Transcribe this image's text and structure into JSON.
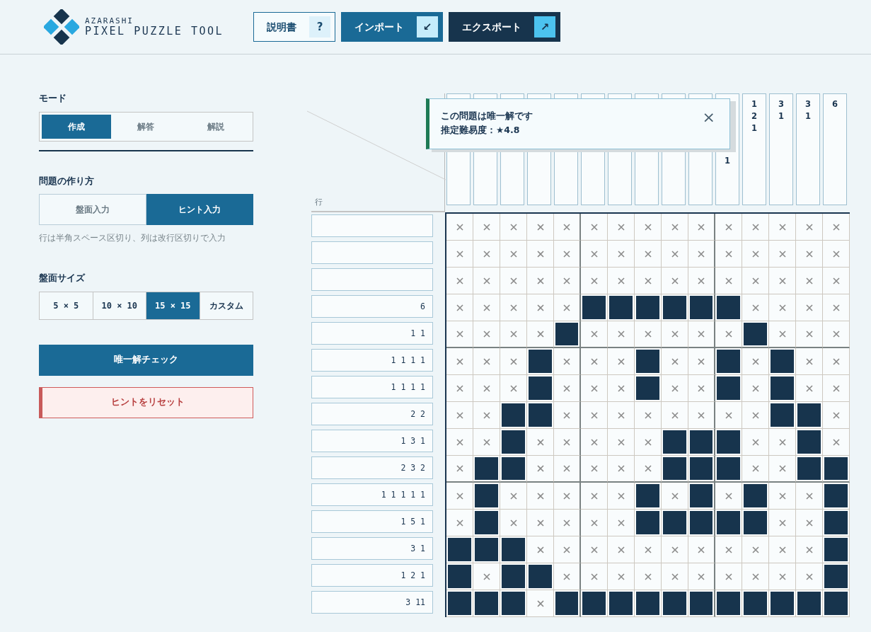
{
  "header": {
    "logo_top": "AZARASHI",
    "logo_title": "PIXEL PUZZLE TOOL",
    "buttons": [
      {
        "label": "説明書",
        "icon": "?",
        "kind": "outline"
      },
      {
        "label": "インポート",
        "icon": "↙",
        "kind": "primary"
      },
      {
        "label": "エクスポート",
        "icon": "↗",
        "kind": "dark"
      }
    ]
  },
  "sidebar": {
    "mode": {
      "heading": "モード",
      "options": [
        {
          "label": "作成",
          "selected": true
        },
        {
          "label": "解答",
          "selected": false
        },
        {
          "label": "解説",
          "selected": false
        }
      ]
    },
    "method": {
      "heading": "問題の作り方",
      "options": [
        {
          "label": "盤面入力",
          "selected": false
        },
        {
          "label": "ヒント入力",
          "selected": true
        }
      ],
      "note": "行は半角スペース区切り、列は改行区切りで入力"
    },
    "size": {
      "heading": "盤面サイズ",
      "options": [
        {
          "label": "5 × 5",
          "selected": false
        },
        {
          "label": "10 × 10",
          "selected": false
        },
        {
          "label": "15 × 15",
          "selected": true
        },
        {
          "label": "カスタム",
          "selected": false
        }
      ]
    },
    "actions": [
      {
        "label": "唯一解チェック",
        "kind": "primary"
      },
      {
        "label": "ヒントをリセット",
        "kind": "danger"
      }
    ]
  },
  "board": {
    "row_label": "行",
    "visible_column_hints": [
      {
        "lines": [
          "1"
        ],
        "partly_hidden": true
      },
      {
        "lines": [
          "1",
          "2",
          "1"
        ],
        "partly_hidden": false
      },
      {
        "lines": [
          "3",
          "1"
        ],
        "partly_hidden": false
      },
      {
        "lines": [
          "3",
          "1"
        ],
        "partly_hidden": false
      },
      {
        "lines": [
          "6"
        ],
        "partly_hidden": false
      }
    ],
    "lower_row_hints": [
      {
        "value": "6"
      },
      {
        "value": "1 1"
      },
      {
        "value": "1 1 1 1"
      },
      {
        "value": "1 1 1 1"
      },
      {
        "value": "2 2"
      },
      {
        "value": "1 3 1"
      },
      {
        "value": "2 3 2"
      },
      {
        "value": "1 1 1 1 1"
      },
      {
        "value": "1 5 1"
      },
      {
        "value": "3 1"
      },
      {
        "value": "1 2 1"
      },
      {
        "value": "3 11"
      }
    ],
    "grid": [
      {
        "filled": [
          false,
          false,
          false,
          false,
          false,
          false,
          false,
          false,
          false,
          false,
          false,
          false,
          false,
          false,
          false
        ]
      },
      {
        "filled": [
          false,
          false,
          false,
          false,
          false,
          false,
          false,
          false,
          false,
          false,
          false,
          false,
          false,
          false,
          false
        ]
      },
      {
        "filled": [
          false,
          false,
          false,
          false,
          false,
          false,
          false,
          false,
          false,
          false,
          false,
          false,
          false,
          false,
          false
        ]
      },
      {
        "filled": [
          false,
          false,
          false,
          false,
          false,
          true,
          true,
          true,
          true,
          true,
          true,
          false,
          false,
          false,
          false
        ]
      },
      {
        "filled": [
          false,
          false,
          false,
          false,
          true,
          false,
          false,
          false,
          false,
          false,
          false,
          true,
          false,
          false,
          false
        ]
      },
      {
        "filled": [
          false,
          false,
          false,
          true,
          false,
          false,
          false,
          true,
          false,
          false,
          true,
          false,
          true,
          false,
          false
        ]
      },
      {
        "filled": [
          false,
          false,
          false,
          true,
          false,
          false,
          false,
          true,
          false,
          false,
          true,
          false,
          true,
          false,
          false
        ]
      },
      {
        "filled": [
          false,
          false,
          true,
          true,
          false,
          false,
          false,
          false,
          false,
          false,
          false,
          false,
          true,
          true,
          false
        ]
      },
      {
        "filled": [
          false,
          false,
          true,
          false,
          false,
          false,
          false,
          false,
          true,
          true,
          true,
          false,
          false,
          true,
          false
        ]
      },
      {
        "filled": [
          false,
          true,
          true,
          false,
          false,
          false,
          false,
          false,
          true,
          true,
          true,
          false,
          false,
          true,
          true
        ]
      },
      {
        "filled": [
          false,
          true,
          false,
          false,
          false,
          false,
          false,
          true,
          false,
          true,
          false,
          true,
          false,
          false,
          true
        ]
      },
      {
        "filled": [
          false,
          true,
          false,
          false,
          false,
          false,
          false,
          true,
          true,
          true,
          true,
          true,
          false,
          false,
          true
        ]
      },
      {
        "filled": [
          true,
          true,
          true,
          false,
          false,
          false,
          false,
          false,
          false,
          false,
          false,
          false,
          false,
          false,
          true
        ]
      },
      {
        "filled": [
          true,
          false,
          true,
          true,
          false,
          false,
          false,
          false,
          false,
          false,
          false,
          false,
          false,
          false,
          true
        ]
      },
      {
        "filled": [
          true,
          true,
          true,
          false,
          true,
          true,
          true,
          true,
          true,
          true,
          true,
          true,
          true,
          true,
          true
        ]
      }
    ]
  },
  "toast": {
    "title": "この問題は唯一解です",
    "detail": "推定難易度：★4.8",
    "close": "×"
  }
}
